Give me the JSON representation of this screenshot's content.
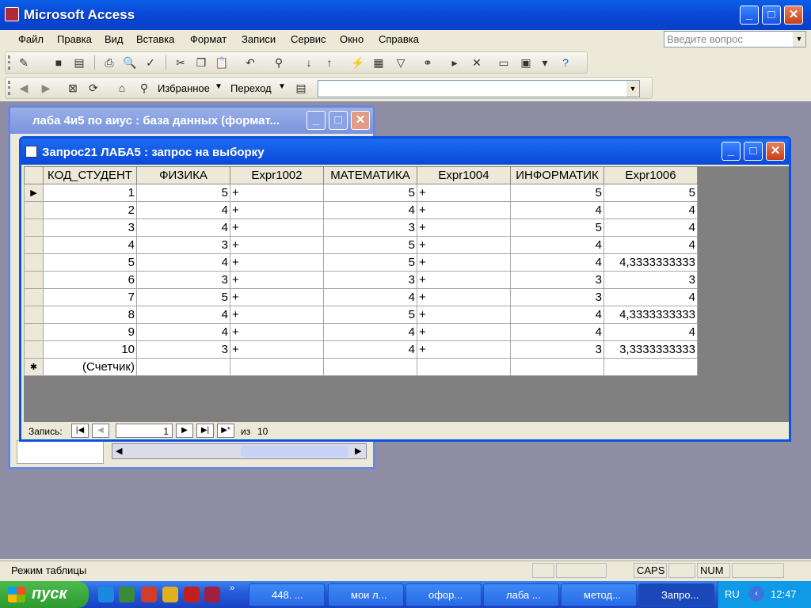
{
  "app": {
    "title": "Microsoft Access"
  },
  "menu": [
    "Файл",
    "Правка",
    "Вид",
    "Вставка",
    "Формат",
    "Записи",
    "Сервис",
    "Окно",
    "Справка"
  ],
  "ask_placeholder": "Введите вопрос",
  "web_toolbar": {
    "favorites": "Избранное",
    "go": "Переход"
  },
  "db_window": {
    "title": "лаба 4и5 по аиус : база данных (формат..."
  },
  "query_window": {
    "title": "Запрос21 ЛАБА5 : запрос на выборку",
    "columns": [
      "КОД_СТУДЕНТ",
      "ФИЗИКА",
      "Expr1002",
      "МАТЕМАТИКА",
      "Expr1004",
      "ИНФОРМАТИК",
      "Expr1006"
    ],
    "rows": [
      [
        "1",
        "5",
        "+",
        "5",
        "+",
        "5",
        "5"
      ],
      [
        "2",
        "4",
        "+",
        "4",
        "+",
        "4",
        "4"
      ],
      [
        "3",
        "4",
        "+",
        "3",
        "+",
        "5",
        "4"
      ],
      [
        "4",
        "3",
        "+",
        "5",
        "+",
        "4",
        "4"
      ],
      [
        "5",
        "4",
        "+",
        "5",
        "+",
        "4",
        "4,3333333333"
      ],
      [
        "6",
        "3",
        "+",
        "3",
        "+",
        "3",
        "3"
      ],
      [
        "7",
        "5",
        "+",
        "4",
        "+",
        "3",
        "4"
      ],
      [
        "8",
        "4",
        "+",
        "5",
        "+",
        "4",
        "4,3333333333"
      ],
      [
        "9",
        "4",
        "+",
        "4",
        "+",
        "4",
        "4"
      ],
      [
        "10",
        "3",
        "+",
        "4",
        "+",
        "3",
        "3,3333333333"
      ]
    ],
    "new_row_label": "(Счетчик)",
    "nav": {
      "label": "Запись:",
      "current": "1",
      "of_text": "из",
      "total": "10"
    }
  },
  "status": {
    "mode": "Режим таблицы",
    "caps": "CAPS",
    "num": "NUM"
  },
  "taskbar": {
    "start": "пуск",
    "tasks": [
      "448. ...",
      "мои л...",
      "офор...",
      "лаба ...",
      "метод...",
      "Запро..."
    ],
    "lang": "RU",
    "clock": "12:47"
  }
}
